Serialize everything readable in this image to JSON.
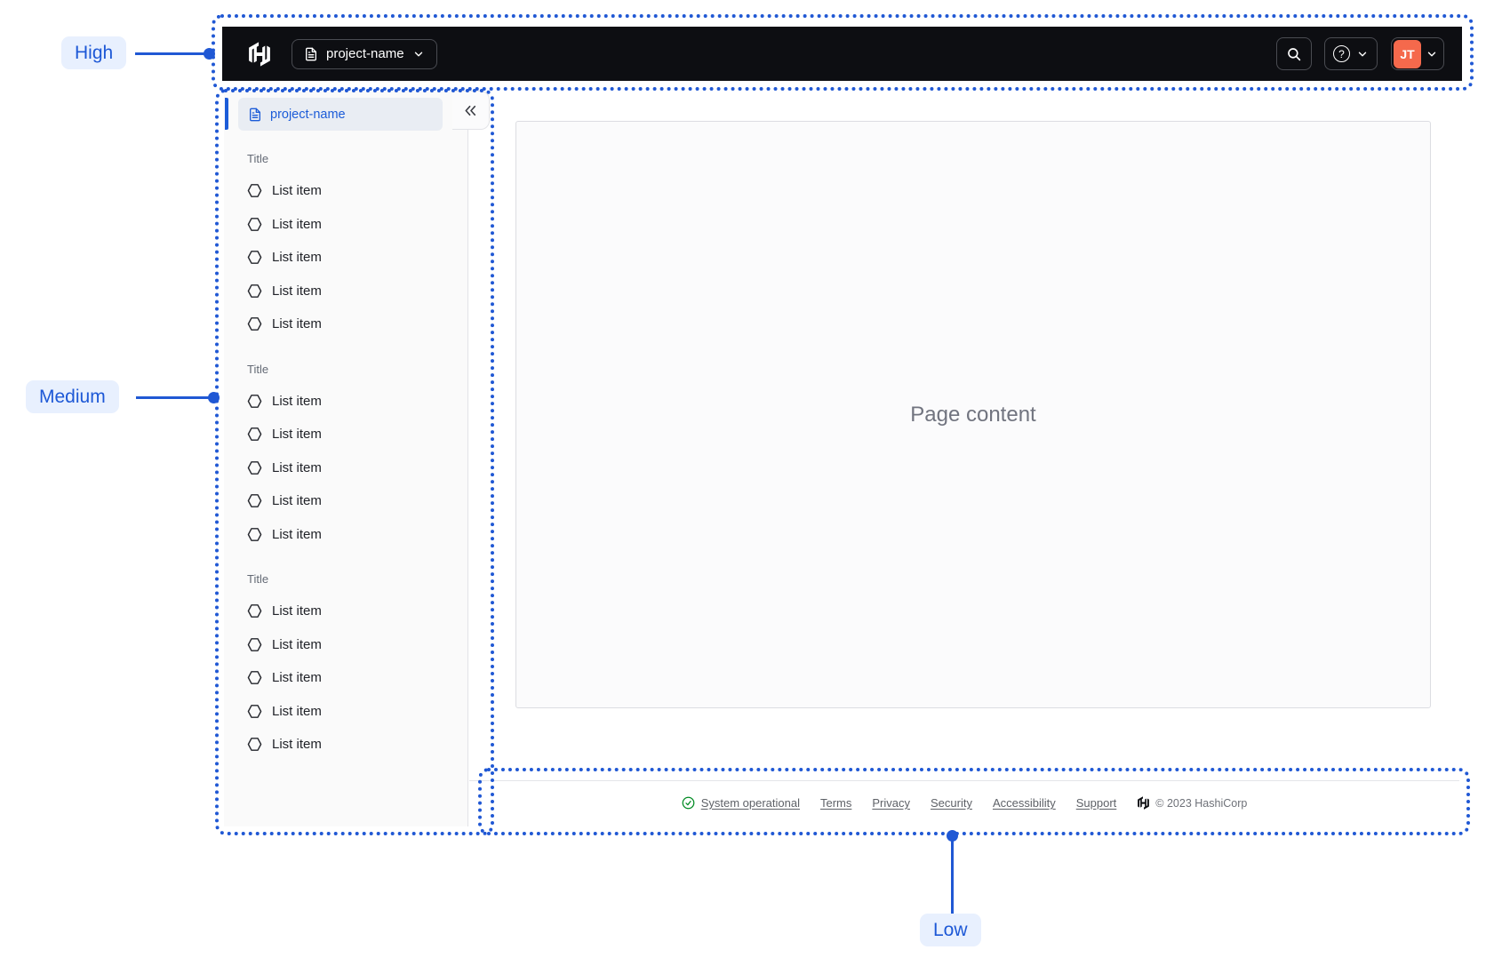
{
  "annotations": {
    "high": {
      "label": "High"
    },
    "medium": {
      "label": "Medium"
    },
    "low": {
      "label": "Low"
    },
    "accent_color": "#2058d4",
    "pill_bg": "#e8f0fe"
  },
  "navbar": {
    "logo": "hashicorp-logo",
    "background": "#0d0e12",
    "project_switcher": {
      "icon": "file-text-icon",
      "label": "project-name",
      "chevron": "chevron-down-icon"
    },
    "search": {
      "icon": "search-icon"
    },
    "help": {
      "icon": "help-icon",
      "chevron": "chevron-down-icon"
    },
    "profile": {
      "avatar_initials": "JT",
      "avatar_color": "#f5694c",
      "chevron": "chevron-down-icon"
    }
  },
  "sidebar": {
    "project_label": "project-name",
    "project_icon": "file-text-icon",
    "collapse_icon": "chevron-double-left-icon",
    "active_color": "#1c5cd8",
    "sections": [
      {
        "title": "Title",
        "icon": "hexagon-icon",
        "items": [
          "List item",
          "List item",
          "List item",
          "List item",
          "List item"
        ]
      },
      {
        "title": "Title",
        "icon": "hexagon-icon",
        "items": [
          "List item",
          "List item",
          "List item",
          "List item",
          "List item"
        ]
      },
      {
        "title": "Title",
        "icon": "hexagon-icon",
        "items": [
          "List item",
          "List item",
          "List item",
          "List item",
          "List item"
        ]
      }
    ]
  },
  "main": {
    "placeholder": "Page content"
  },
  "footer": {
    "status": {
      "icon": "check-circle-icon",
      "color": "#008a22",
      "label": "System operational"
    },
    "links": [
      "Terms",
      "Privacy",
      "Security",
      "Accessibility",
      "Support"
    ],
    "logo": "hashicorp-logo",
    "copyright": "© 2023 HashiCorp"
  }
}
